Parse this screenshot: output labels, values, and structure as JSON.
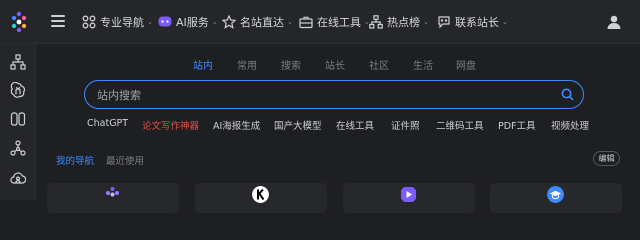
{
  "header": {
    "nav": [
      {
        "label": "专业导航",
        "icon": "grid-icon",
        "has_menu": true
      },
      {
        "label": "AI服务",
        "icon": "ai-chat-icon",
        "has_menu": true
      },
      {
        "label": "名站直达",
        "icon": "star-icon",
        "has_menu": true
      },
      {
        "label": "在线工具",
        "icon": "toolbox-icon",
        "has_menu": true
      },
      {
        "label": "热点榜",
        "icon": "sitemap-icon",
        "has_menu": true
      },
      {
        "label": "联系站长",
        "icon": "contact-icon",
        "has_menu": true
      }
    ],
    "chevron": "⌄",
    "user_icon": "user-icon"
  },
  "sidebar": {
    "icons": [
      "sitemap-icon",
      "openai-icon",
      "dual-panel-icon",
      "network-icon",
      "cloud-user-icon"
    ]
  },
  "search": {
    "tabs": [
      "站内",
      "常用",
      "搜索",
      "站长",
      "社区",
      "生活",
      "网盘"
    ],
    "active_tab": "站内",
    "placeholder": "站内搜索",
    "quick_links": [
      "ChatGPT",
      "论文写作神器",
      "AI海报生成",
      "国产大模型",
      "在线工具",
      "证件照",
      "二维码工具",
      "PDF工具",
      "视频处理"
    ],
    "hot_link": "论文写作神器"
  },
  "nav_section": {
    "tabs": [
      "我的导航",
      "最近使用"
    ],
    "active_tab": "我的导航",
    "edit_label": "编辑"
  },
  "colors": {
    "accent": "#3d8bff",
    "hot": "#e0524a",
    "background": "#1e1f22",
    "bar": "#25262a"
  }
}
